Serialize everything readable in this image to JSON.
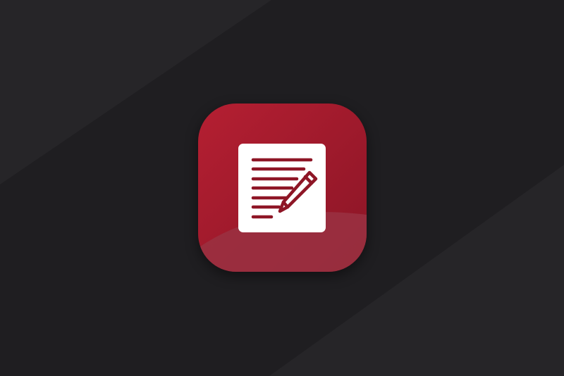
{
  "background": {
    "base_color": "#1f1e21",
    "stripe_color": "#262528"
  },
  "app_icon": {
    "semantic": "notes-edit-app-icon",
    "gradient_top": "#b51f32",
    "gradient_bottom": "#8a1526",
    "gloss_color": "#9a3142",
    "document_color": "#ffffff",
    "glyph_color": "#8e1626",
    "icons": [
      "document-lines-icon",
      "pencil-icon"
    ]
  }
}
